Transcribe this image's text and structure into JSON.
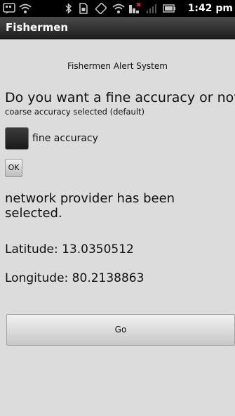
{
  "status_bar": {
    "icons": [
      "bbm-icon",
      "wifi-icon",
      "bluetooth-icon",
      "sim-icon",
      "rotation-icon",
      "wifi-signal-icon",
      "notification-icon",
      "cell-signal-icon",
      "battery-icon"
    ],
    "time": "1:42 pm"
  },
  "app": {
    "title": "Fishermen"
  },
  "main": {
    "header": "Fishermen Alert System",
    "question": "Do you want a fine accuracy or not?",
    "accuracy_note": "coarse accuracy selected (default)",
    "checkbox": {
      "label": "fine accuracy",
      "checked": false
    },
    "ok_label": "OK",
    "provider_status": "network provider has been selected.",
    "latitude": "Latitude: 13.0350512",
    "longitude": "Longitude: 80.2138863",
    "go_label": "Go"
  },
  "colors": {
    "background": "#dcdcdc",
    "status_bar": "#000000",
    "title_bar": "#2b2b2b"
  }
}
